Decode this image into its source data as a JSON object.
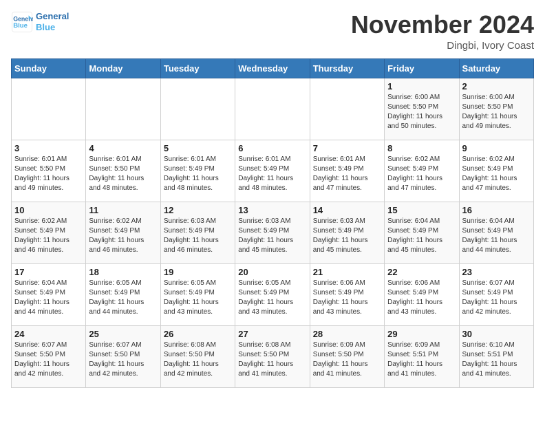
{
  "header": {
    "logo_line1": "General",
    "logo_line2": "Blue",
    "month_title": "November 2024",
    "location": "Dingbi, Ivory Coast"
  },
  "days_of_week": [
    "Sunday",
    "Monday",
    "Tuesday",
    "Wednesday",
    "Thursday",
    "Friday",
    "Saturday"
  ],
  "weeks": [
    [
      {
        "day": "",
        "detail": ""
      },
      {
        "day": "",
        "detail": ""
      },
      {
        "day": "",
        "detail": ""
      },
      {
        "day": "",
        "detail": ""
      },
      {
        "day": "",
        "detail": ""
      },
      {
        "day": "1",
        "detail": "Sunrise: 6:00 AM\nSunset: 5:50 PM\nDaylight: 11 hours\nand 50 minutes."
      },
      {
        "day": "2",
        "detail": "Sunrise: 6:00 AM\nSunset: 5:50 PM\nDaylight: 11 hours\nand 49 minutes."
      }
    ],
    [
      {
        "day": "3",
        "detail": "Sunrise: 6:01 AM\nSunset: 5:50 PM\nDaylight: 11 hours\nand 49 minutes."
      },
      {
        "day": "4",
        "detail": "Sunrise: 6:01 AM\nSunset: 5:50 PM\nDaylight: 11 hours\nand 48 minutes."
      },
      {
        "day": "5",
        "detail": "Sunrise: 6:01 AM\nSunset: 5:49 PM\nDaylight: 11 hours\nand 48 minutes."
      },
      {
        "day": "6",
        "detail": "Sunrise: 6:01 AM\nSunset: 5:49 PM\nDaylight: 11 hours\nand 48 minutes."
      },
      {
        "day": "7",
        "detail": "Sunrise: 6:01 AM\nSunset: 5:49 PM\nDaylight: 11 hours\nand 47 minutes."
      },
      {
        "day": "8",
        "detail": "Sunrise: 6:02 AM\nSunset: 5:49 PM\nDaylight: 11 hours\nand 47 minutes."
      },
      {
        "day": "9",
        "detail": "Sunrise: 6:02 AM\nSunset: 5:49 PM\nDaylight: 11 hours\nand 47 minutes."
      }
    ],
    [
      {
        "day": "10",
        "detail": "Sunrise: 6:02 AM\nSunset: 5:49 PM\nDaylight: 11 hours\nand 46 minutes."
      },
      {
        "day": "11",
        "detail": "Sunrise: 6:02 AM\nSunset: 5:49 PM\nDaylight: 11 hours\nand 46 minutes."
      },
      {
        "day": "12",
        "detail": "Sunrise: 6:03 AM\nSunset: 5:49 PM\nDaylight: 11 hours\nand 46 minutes."
      },
      {
        "day": "13",
        "detail": "Sunrise: 6:03 AM\nSunset: 5:49 PM\nDaylight: 11 hours\nand 45 minutes."
      },
      {
        "day": "14",
        "detail": "Sunrise: 6:03 AM\nSunset: 5:49 PM\nDaylight: 11 hours\nand 45 minutes."
      },
      {
        "day": "15",
        "detail": "Sunrise: 6:04 AM\nSunset: 5:49 PM\nDaylight: 11 hours\nand 45 minutes."
      },
      {
        "day": "16",
        "detail": "Sunrise: 6:04 AM\nSunset: 5:49 PM\nDaylight: 11 hours\nand 44 minutes."
      }
    ],
    [
      {
        "day": "17",
        "detail": "Sunrise: 6:04 AM\nSunset: 5:49 PM\nDaylight: 11 hours\nand 44 minutes."
      },
      {
        "day": "18",
        "detail": "Sunrise: 6:05 AM\nSunset: 5:49 PM\nDaylight: 11 hours\nand 44 minutes."
      },
      {
        "day": "19",
        "detail": "Sunrise: 6:05 AM\nSunset: 5:49 PM\nDaylight: 11 hours\nand 43 minutes."
      },
      {
        "day": "20",
        "detail": "Sunrise: 6:05 AM\nSunset: 5:49 PM\nDaylight: 11 hours\nand 43 minutes."
      },
      {
        "day": "21",
        "detail": "Sunrise: 6:06 AM\nSunset: 5:49 PM\nDaylight: 11 hours\nand 43 minutes."
      },
      {
        "day": "22",
        "detail": "Sunrise: 6:06 AM\nSunset: 5:49 PM\nDaylight: 11 hours\nand 43 minutes."
      },
      {
        "day": "23",
        "detail": "Sunrise: 6:07 AM\nSunset: 5:49 PM\nDaylight: 11 hours\nand 42 minutes."
      }
    ],
    [
      {
        "day": "24",
        "detail": "Sunrise: 6:07 AM\nSunset: 5:50 PM\nDaylight: 11 hours\nand 42 minutes."
      },
      {
        "day": "25",
        "detail": "Sunrise: 6:07 AM\nSunset: 5:50 PM\nDaylight: 11 hours\nand 42 minutes."
      },
      {
        "day": "26",
        "detail": "Sunrise: 6:08 AM\nSunset: 5:50 PM\nDaylight: 11 hours\nand 42 minutes."
      },
      {
        "day": "27",
        "detail": "Sunrise: 6:08 AM\nSunset: 5:50 PM\nDaylight: 11 hours\nand 41 minutes."
      },
      {
        "day": "28",
        "detail": "Sunrise: 6:09 AM\nSunset: 5:50 PM\nDaylight: 11 hours\nand 41 minutes."
      },
      {
        "day": "29",
        "detail": "Sunrise: 6:09 AM\nSunset: 5:51 PM\nDaylight: 11 hours\nand 41 minutes."
      },
      {
        "day": "30",
        "detail": "Sunrise: 6:10 AM\nSunset: 5:51 PM\nDaylight: 11 hours\nand 41 minutes."
      }
    ]
  ]
}
